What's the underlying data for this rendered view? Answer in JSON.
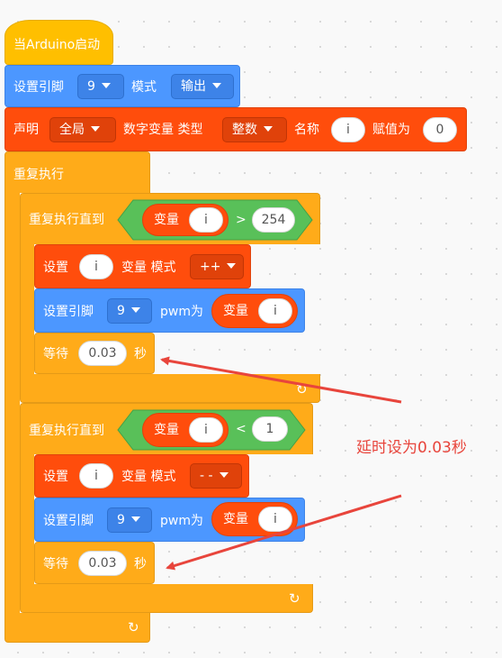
{
  "hat": {
    "label": "当Arduino启动"
  },
  "pin_mode_block": {
    "label": "设置引脚",
    "pin": "9",
    "mode_label": "模式",
    "mode": "输出"
  },
  "declare_block": {
    "label": "声明",
    "scope": "全局",
    "type_label": "数字变量 类型",
    "type": "整数",
    "name_label": "名称",
    "name": "i",
    "assign_label": "赋值为",
    "value": "0"
  },
  "forever": {
    "label": "重复执行"
  },
  "loop1": {
    "label": "重复执行直到",
    "cond": {
      "var_label": "变量",
      "var": "i",
      "op": ">",
      "value": "254"
    },
    "set_block": {
      "label": "设置",
      "var": "i",
      "mode_label": "变量 模式",
      "mode": "++"
    },
    "pwm_block": {
      "label": "设置引脚",
      "pin": "9",
      "pwm_label": "pwm为",
      "var_label": "变量",
      "var": "i"
    },
    "wait_block": {
      "label": "等待",
      "value": "0.03",
      "unit": "秒"
    }
  },
  "loop2": {
    "label": "重复执行直到",
    "cond": {
      "var_label": "变量",
      "var": "i",
      "op": "<",
      "value": "1"
    },
    "set_block": {
      "label": "设置",
      "var": "i",
      "mode_label": "变量 模式",
      "mode": "- -"
    },
    "pwm_block": {
      "label": "设置引脚",
      "pin": "9",
      "pwm_label": "pwm为",
      "var_label": "变量",
      "var": "i"
    },
    "wait_block": {
      "label": "等待",
      "value": "0.03",
      "unit": "秒"
    }
  },
  "annotation": {
    "text": "延时设为0.03秒",
    "color": "#e8453c"
  },
  "colors": {
    "control": "#ffab19",
    "pins": "#4c97ff",
    "variables": "#ff4d0c",
    "operators": "#59c059"
  }
}
